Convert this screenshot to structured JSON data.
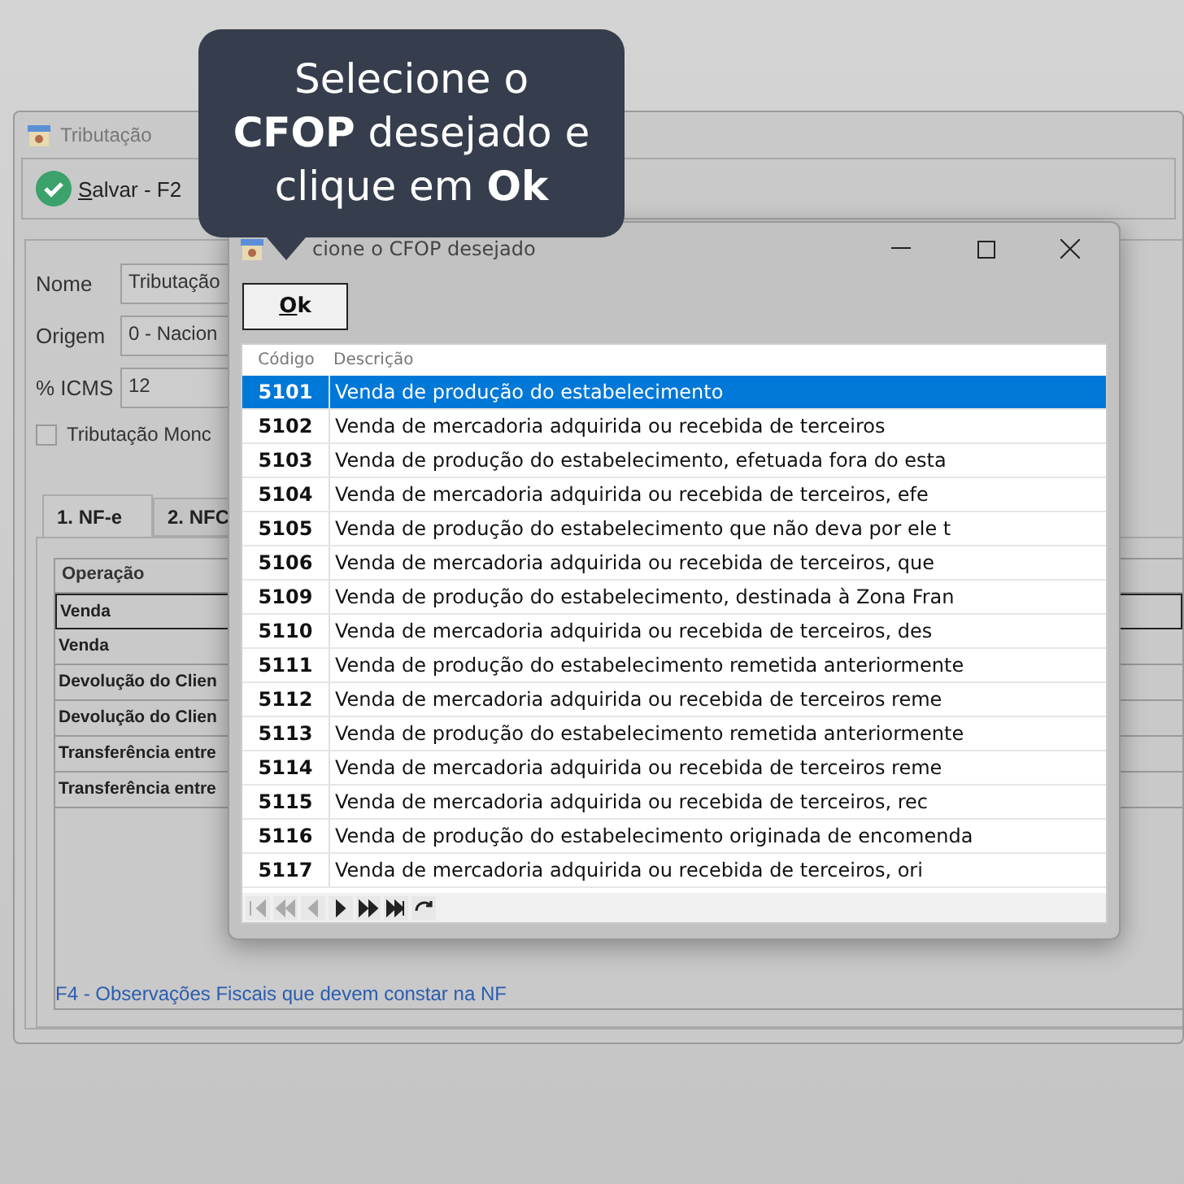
{
  "main_window": {
    "title": "Tributação",
    "toolbar": [
      {
        "label": "Salvar - F2"
      }
    ],
    "fields": [
      {
        "label": "Nome",
        "value": "Tributação"
      },
      {
        "label": "Origem",
        "value": "0 - Nacion"
      },
      {
        "label": "% ICMS",
        "value": "12"
      }
    ],
    "checkbox": {
      "label": "Tributação Monc",
      "checked": false
    },
    "tabs": [
      {
        "label": "1. NF-e",
        "selected": true
      },
      {
        "label": "2. NFC",
        "selected": false
      }
    ],
    "table": {
      "columns": [
        "Operação"
      ],
      "rows": [
        {
          "operation": "Venda",
          "selected": true
        },
        {
          "operation": "Venda",
          "selected": false
        },
        {
          "operation": "Devolução do Clien",
          "selected": false
        },
        {
          "operation": "Devolução do Clien",
          "selected": false
        },
        {
          "operation": "Transferência entre",
          "selected": false
        },
        {
          "operation": "Transferência entre",
          "selected": false
        }
      ]
    },
    "footer_link": "F4 - Observações Fiscais que devem constar na NF"
  },
  "dialog": {
    "title": "cione o CFOP desejado",
    "ok_button": "Ok",
    "grid": {
      "columns": [
        "Código",
        "Descrição"
      ],
      "rows": [
        {
          "code": "5101",
          "description": "Venda de produção do estabelecimento",
          "selected": true
        },
        {
          "code": "5102",
          "description": "Venda de mercadoria adquirida ou recebida de terceiros",
          "selected": false
        },
        {
          "code": "5103",
          "description": "Venda de produção do estabelecimento, efetuada fora do esta",
          "selected": false
        },
        {
          "code": "5104",
          "description": "Venda de mercadoria adquirida ou recebida de terceiros, efe",
          "selected": false
        },
        {
          "code": "5105",
          "description": "Venda de produção do estabelecimento que não deva por ele t",
          "selected": false
        },
        {
          "code": "5106",
          "description": "Venda de mercadoria adquirida ou recebida de terceiros, que",
          "selected": false
        },
        {
          "code": "5109",
          "description": "Venda de produção do estabelecimento, destinada à Zona Fran",
          "selected": false
        },
        {
          "code": "5110",
          "description": "Venda de mercadoria adquirida ou recebida de terceiros, des",
          "selected": false
        },
        {
          "code": "5111",
          "description": "Venda de produção do estabelecimento remetida anteriormente",
          "selected": false
        },
        {
          "code": "5112",
          "description": "Venda de mercadoria adquirida ou recebida de terceiros reme",
          "selected": false
        },
        {
          "code": "5113",
          "description": "Venda de produção do estabelecimento remetida anteriormente",
          "selected": false
        },
        {
          "code": "5114",
          "description": "Venda de mercadoria adquirida ou recebida de terceiros reme",
          "selected": false
        },
        {
          "code": "5115",
          "description": "Venda de mercadoria adquirida ou recebida de terceiros, rec",
          "selected": false
        },
        {
          "code": "5116",
          "description": "Venda de produção do estabelecimento originada de encomenda",
          "selected": false
        },
        {
          "code": "5117",
          "description": "Venda de mercadoria adquirida ou recebida de terceiros, ori",
          "selected": false
        }
      ]
    }
  },
  "tooltip": {
    "text": "Selecione o **CFOP** desejado e clique em **Ok**"
  }
}
